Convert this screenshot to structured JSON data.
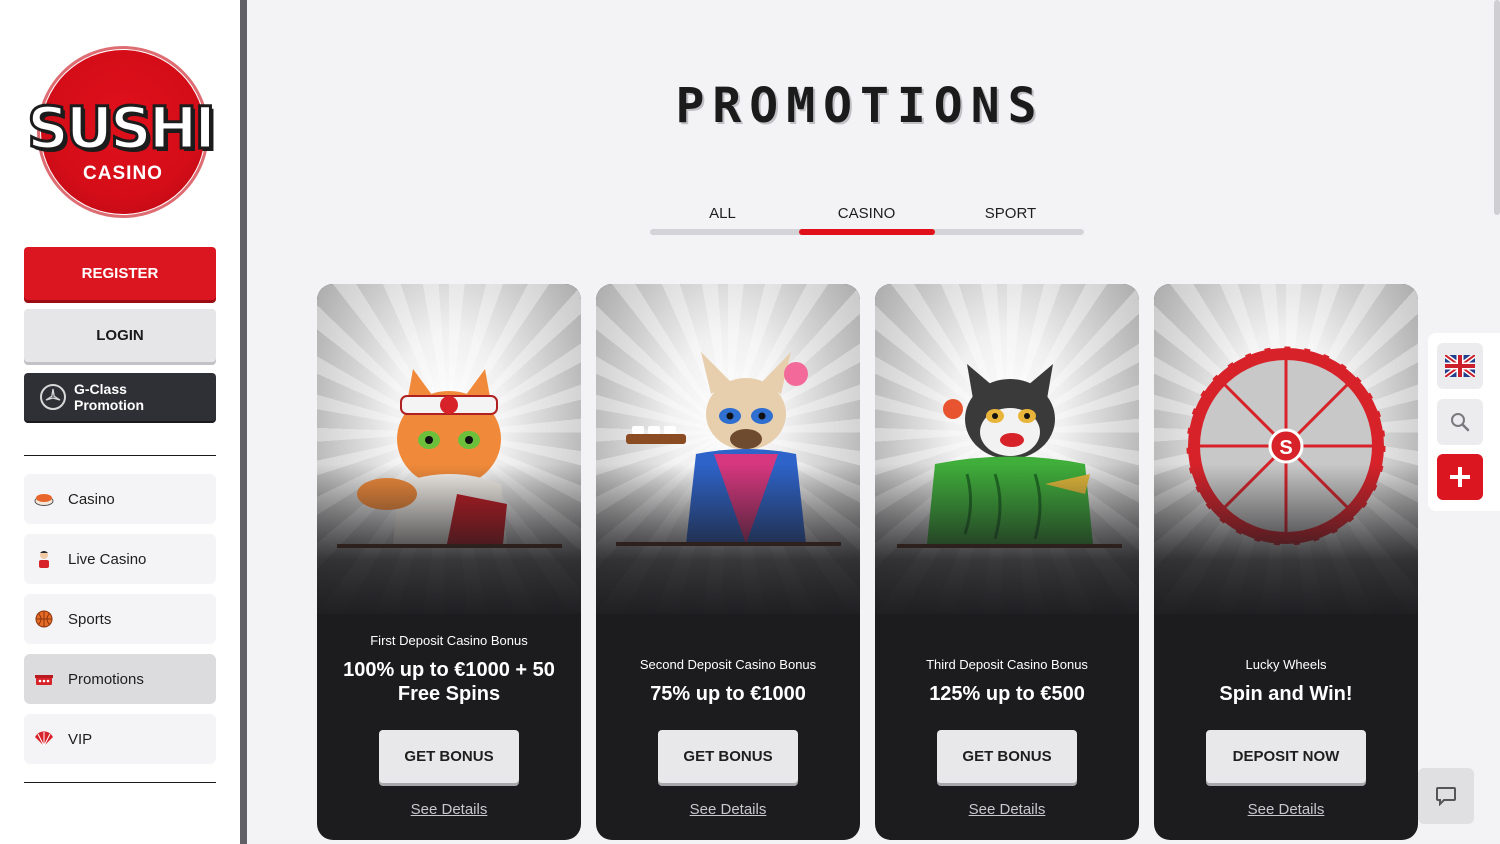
{
  "brand": {
    "logo_main": "SUSHI",
    "logo_sub": "CASINO",
    "accent_color": "#dc1620"
  },
  "sidebar": {
    "register_label": "REGISTER",
    "login_label": "LOGIN",
    "promo_banner_label": "G-Class Promotion",
    "items": [
      {
        "label": "Casino",
        "icon": "sushi-icon"
      },
      {
        "label": "Live Casino",
        "icon": "dealer-icon"
      },
      {
        "label": "Sports",
        "icon": "basketball-icon"
      },
      {
        "label": "Promotions",
        "icon": "gift-box-icon",
        "active": true
      },
      {
        "label": "VIP",
        "icon": "fan-icon"
      }
    ]
  },
  "main": {
    "title": "PROMOTIONS",
    "tabs": [
      {
        "label": "ALL"
      },
      {
        "label": "CASINO",
        "selected": true
      },
      {
        "label": "SPORT"
      }
    ],
    "cards": [
      {
        "subtitle": "First Deposit Casino Bonus",
        "headline": "100% up to €1000 + 50 Free Spins",
        "button": "GET BONUS",
        "link": "See Details"
      },
      {
        "subtitle": "Second Deposit Casino Bonus",
        "headline": "75% up to €1000",
        "button": "GET BONUS",
        "link": "See Details"
      },
      {
        "subtitle": "Third Deposit Casino Bonus",
        "headline": "125% up to €500",
        "button": "GET BONUS",
        "link": "See Details"
      },
      {
        "subtitle": "Lucky Wheels",
        "headline": "Spin and Win!",
        "button": "DEPOSIT NOW",
        "link": "See Details"
      }
    ]
  },
  "floating": {
    "language_icon": "uk-flag-icon",
    "search_icon": "search-icon",
    "plus_icon": "plus-icon",
    "chat_icon": "chat-bubble-icon"
  }
}
